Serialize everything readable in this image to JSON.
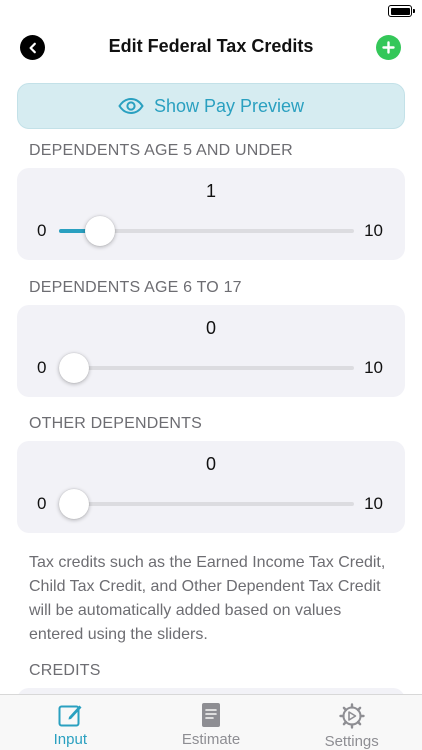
{
  "nav": {
    "title": "Edit Federal Tax Credits",
    "back_icon": "chevron-left-icon",
    "add_icon": "plus-icon"
  },
  "preview_button": {
    "label": "Show Pay Preview",
    "icon": "eye-icon"
  },
  "sliders": [
    {
      "header": "DEPENDENTS AGE 5 AND UNDER",
      "value": "1",
      "min": "0",
      "max": "10",
      "fraction": 0.1
    },
    {
      "header": "DEPENDENTS AGE 6 TO 17",
      "value": "0",
      "min": "0",
      "max": "10",
      "fraction": 0
    },
    {
      "header": "OTHER DEPENDENTS",
      "value": "0",
      "min": "0",
      "max": "10",
      "fraction": 0
    }
  ],
  "note": "Tax credits such as the Earned Income Tax Credit, Child Tax Credit, and Other Dependent Tax Credit will be automatically added based on values entered using the sliders.",
  "credits_header": "CREDITS",
  "tabs": [
    {
      "label": "Input",
      "icon": "edit-icon",
      "active": true
    },
    {
      "label": "Estimate",
      "icon": "document-icon",
      "active": false
    },
    {
      "label": "Settings",
      "icon": "gear-icon",
      "active": false
    }
  ],
  "colors": {
    "accent": "#2aa0c0",
    "add_button": "#34c759",
    "card_background": "#f2f2f7",
    "preview_background": "#d6ecf1"
  }
}
